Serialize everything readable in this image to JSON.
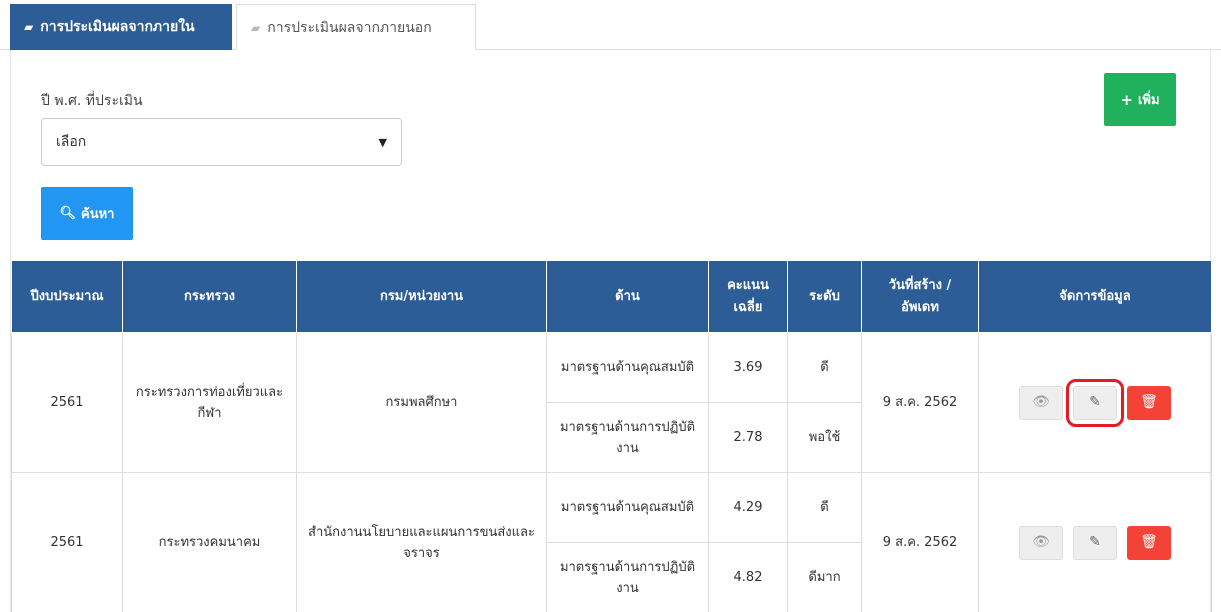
{
  "tabs": [
    {
      "label": "การประเมินผลจากภายใน",
      "icon": "book-icon",
      "active": true
    },
    {
      "label": "การประเมินผลจากภายนอก",
      "icon": "book-icon",
      "active": false
    }
  ],
  "filter": {
    "year_label": "ปี พ.ศ. ที่ประเมิน",
    "select_value": "เลือก"
  },
  "buttons": {
    "search_label": "ค้นหา",
    "add_label": "เพิ่ม"
  },
  "table": {
    "headers": [
      "ปีงบประมาณ",
      "กระทรวง",
      "กรม/หน่วยงาน",
      "ด้าน",
      "คะแนนเฉลี่ย",
      "ระดับ",
      "วันที่สร้าง / อัพเดท",
      "จัดการข้อมูล"
    ],
    "records": [
      {
        "year": "2561",
        "ministry": "กระทรวงการท่องเที่ยวและกีฬา",
        "department": "กรมพลศึกษา",
        "date": "9 ส.ค. 2562",
        "aspects": [
          {
            "aspect": "มาตรฐานด้านคุณสมบัติ",
            "score": "3.69",
            "level": "ดี"
          },
          {
            "aspect": "มาตรฐานด้านการปฏิบัติงาน",
            "score": "2.78",
            "level": "พอใช้"
          }
        ]
      },
      {
        "year": "2561",
        "ministry": "กระทรวงคมนาคม",
        "department": "สำนักงานนโยบายและแผนการขนส่งและจราจร",
        "date": "9 ส.ค. 2562",
        "aspects": [
          {
            "aspect": "มาตรฐานด้านคุณสมบัติ",
            "score": "4.29",
            "level": "ดี"
          },
          {
            "aspect": "มาตรฐานด้านการปฏิบัติงาน",
            "score": "4.82",
            "level": "ดีมาก"
          }
        ]
      }
    ]
  },
  "colors": {
    "primary": "#2d5d96",
    "search": "#2196f3",
    "add": "#21b05b",
    "delete": "#f44336",
    "highlight": "#e31b23"
  }
}
